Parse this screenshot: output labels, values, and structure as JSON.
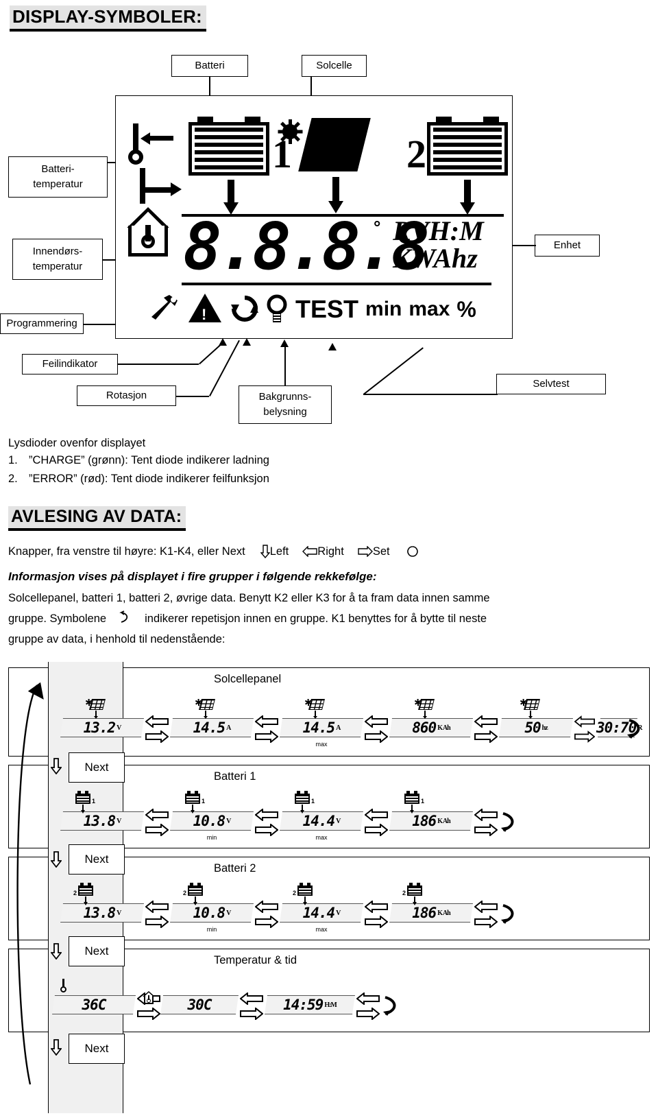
{
  "headings": {
    "display_symbols": "DISPLAY-SYMBOLER:",
    "reading_data": "AVLESING AV DATA:"
  },
  "callouts": {
    "battery": "Batteri",
    "solar_cell": "Solcelle",
    "battery_temp_line1": "Batteri-",
    "battery_temp_line2": "temperatur",
    "indoor_temp_line1": "Innendørs-",
    "indoor_temp_line2": "temperatur",
    "programming": "Programmering",
    "fault_indicator": "Feilindikator",
    "rotation": "Rotasjon",
    "backlight_line1": "Bakgrunns-",
    "backlight_line2": "belysning",
    "unit": "Enhet",
    "selftest": "Selvtest"
  },
  "lcd": {
    "battery1_number": "1",
    "battery2_number": "2",
    "digits": "8.8.8.8",
    "degree": "°",
    "units_line1": "RVH:M",
    "units_line2": "KWAhz",
    "bottom_text": "TEST min max %",
    "bottom_test": "TEST",
    "bottom_min": "min",
    "bottom_max": "max",
    "bottom_percent": "%"
  },
  "leds": {
    "title": "Lysdioder ovenfor displayet",
    "items": [
      {
        "n": "1.",
        "text": "”CHARGE” (grønn): Tent diode indikerer ladning"
      },
      {
        "n": "2.",
        "text": "”ERROR” (rød): Tent diode indikerer feilfunksjon"
      }
    ]
  },
  "buttons_line": {
    "prefix": "Knapper, fra venstre til høyre: K1-K4, eller Next",
    "k1": "Left",
    "k2": "Right",
    "k3": "Set",
    "k4": ""
  },
  "body": {
    "bold_line": "Informasjon vises på displayet i fire grupper i følgende rekkefølge:",
    "p1": "Solcellepanel, batteri 1, batteri 2, øvrige data. Benytt K2 eller K3 for å ta fram data innen samme",
    "p2a": "gruppe. Symbolene",
    "p2b": "indikerer repetisjon innen en gruppe. K1 benyttes for å bytte til neste",
    "p3": "gruppe av data, i henhold til nedenstående:"
  },
  "flow": {
    "next_label": "Next",
    "groups": [
      {
        "label": "Solcellepanel",
        "icon": "solar-icon",
        "readings": [
          {
            "value": "13.2",
            "unit": "V",
            "minmax": ""
          },
          {
            "value": "14.5",
            "unit": "A",
            "minmax": ""
          },
          {
            "value": "14.5",
            "unit": "A",
            "minmax": "max"
          },
          {
            "value": "860",
            "unit": "K Ah",
            "minmax": ""
          },
          {
            "value": "50",
            "unit": "hz",
            "minmax": ""
          },
          {
            "value": "30:70",
            "unit": "R",
            "minmax": ""
          }
        ]
      },
      {
        "label": "Batteri 1",
        "icon": "battery-1-icon",
        "readings": [
          {
            "value": "13.8",
            "unit": "V",
            "minmax": ""
          },
          {
            "value": "10.8",
            "unit": "V",
            "minmax": "min"
          },
          {
            "value": "14.4",
            "unit": "V",
            "minmax": "max"
          },
          {
            "value": "186",
            "unit": "K Ah",
            "minmax": ""
          }
        ]
      },
      {
        "label": "Batteri 2",
        "icon": "battery-2-icon",
        "readings": [
          {
            "value": "13.8",
            "unit": "V",
            "minmax": ""
          },
          {
            "value": "10.8",
            "unit": "V",
            "minmax": "min"
          },
          {
            "value": "14.4",
            "unit": "V",
            "minmax": "max"
          },
          {
            "value": "186",
            "unit": "K Ah",
            "minmax": ""
          }
        ]
      },
      {
        "label": "Temperatur & tid",
        "icon": "thermometer-icon",
        "readings": [
          {
            "value": "36C",
            "unit": "",
            "minmax": ""
          },
          {
            "value": "30C",
            "unit": "",
            "minmax": ""
          },
          {
            "value": "14:59",
            "unit": "H:M",
            "minmax": ""
          }
        ]
      }
    ]
  },
  "colors": {
    "highlight": "#e3e3e3",
    "band": "#f0f0f0",
    "ink": "#000000",
    "lcd_screen": "#f2f2f2"
  }
}
